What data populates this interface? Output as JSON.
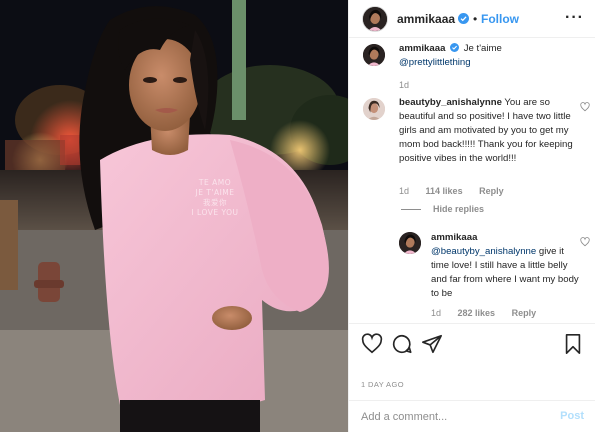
{
  "post": {
    "author": "ammikaaa",
    "follow_label": "Follow",
    "separator": "•",
    "more_icon": "more-horizontal-icon",
    "photo_shirt_lines": [
      "TE AMO",
      "JE T'AIME",
      "我爱你",
      "I LOVE YOU"
    ]
  },
  "comments": [
    {
      "username": "ammikaaa",
      "verified": true,
      "text": "Je t'aime",
      "mention": "@prettylittlething",
      "time": "1d"
    },
    {
      "username": "beautyby_anishalynne",
      "text": "You are so beautiful and so positive! I have two little girls and am motivated by you to get my mom bod back!!!!! Thank you for keeping positive vibes in the world!!!",
      "time": "1d",
      "likes": "114 likes",
      "reply_label": "Reply",
      "hide_replies_label": "Hide replies"
    },
    {
      "username": "ammikaaa",
      "mention": "@beautyby_anishalynne",
      "text": "give it time love! I still have a little belly and far from where I want my body to be",
      "time": "1d",
      "likes": "282 likes",
      "reply_label": "Reply"
    }
  ],
  "actions": {
    "icons": [
      "heart-icon",
      "comment-icon",
      "share-icon",
      "bookmark-icon"
    ]
  },
  "date_label": "1 DAY AGO",
  "add_comment": {
    "placeholder": "Add a comment...",
    "post_label": "Post"
  },
  "colors": {
    "accent": "#3897f0",
    "text": "#262626",
    "muted": "#8e8e8e",
    "mention": "#00376b",
    "post_disabled": "#b2dffc",
    "sweatshirt": "#f3b9cf"
  }
}
